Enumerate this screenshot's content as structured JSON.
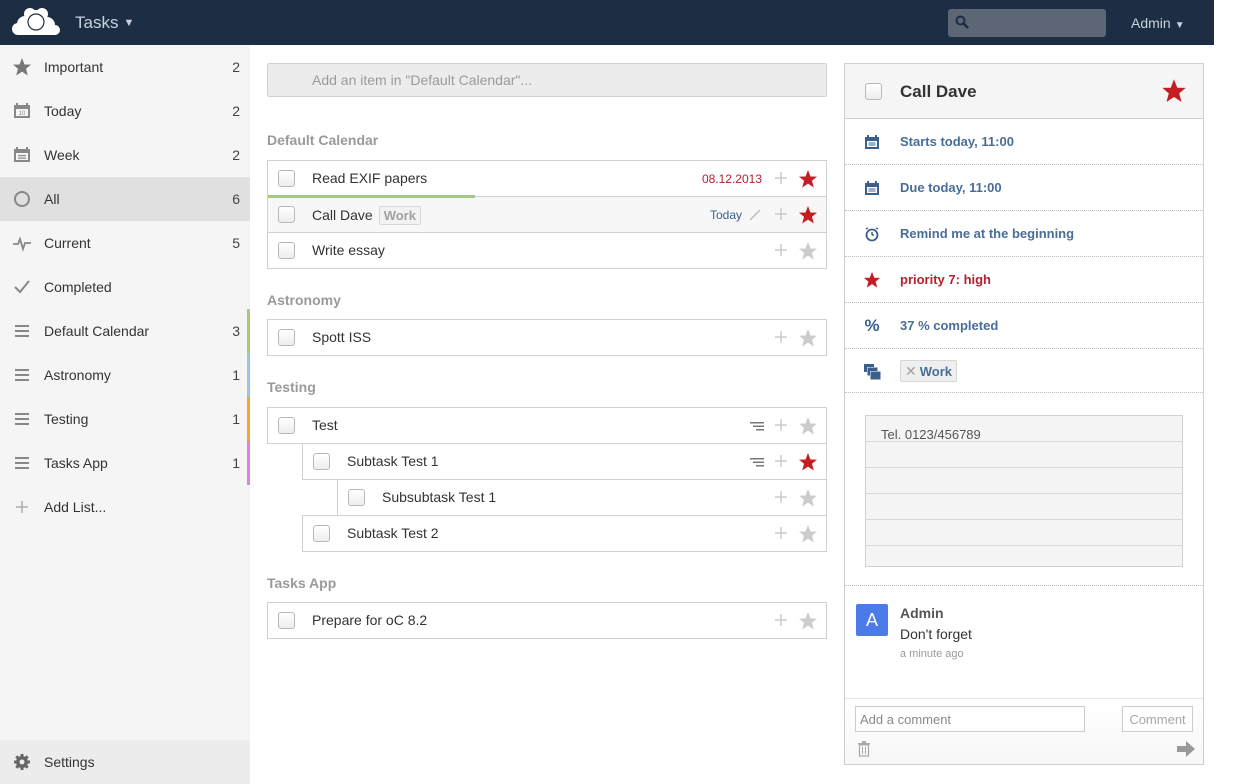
{
  "header": {
    "app_title": "Tasks",
    "search_placeholder": "",
    "user": "Admin"
  },
  "sidebar": {
    "items": [
      {
        "label": "Important",
        "count": "2",
        "icon": "star-icon"
      },
      {
        "label": "Today",
        "count": "2",
        "icon": "calendar-today-icon"
      },
      {
        "label": "Week",
        "count": "2",
        "icon": "calendar-week-icon"
      },
      {
        "label": "All",
        "count": "6",
        "icon": "circle-icon",
        "active": true
      },
      {
        "label": "Current",
        "count": "5",
        "icon": "pulse-icon"
      },
      {
        "label": "Completed",
        "count": "",
        "icon": "check-icon"
      }
    ],
    "lists": [
      {
        "label": "Default Calendar",
        "count": "3",
        "color": "#a5cf6f"
      },
      {
        "label": "Astronomy",
        "count": "1",
        "color": "#9dc3e6"
      },
      {
        "label": "Testing",
        "count": "1",
        "color": "#f5a623"
      },
      {
        "label": "Tasks App",
        "count": "1",
        "color": "#e27ee6"
      }
    ],
    "add_list": "Add List...",
    "settings": "Settings"
  },
  "main": {
    "add_placeholder": "Add an item in \"Default Calendar\"...",
    "groups": [
      {
        "title": "Default Calendar",
        "tasks": [
          {
            "title": "Read EXIF papers",
            "date": "08.12.2013",
            "starred": true
          },
          {
            "title": "Call Dave",
            "tag": "Work",
            "date": "Today",
            "starred": true,
            "selected": true,
            "progress_percent": 37
          },
          {
            "title": "Write essay",
            "starred": false
          }
        ]
      },
      {
        "title": "Astronomy",
        "tasks": [
          {
            "title": "Spott ISS",
            "starred": false
          }
        ]
      },
      {
        "title": "Testing",
        "tasks": [
          {
            "title": "Test",
            "starred": false,
            "has_subtasks": true
          },
          {
            "title": "Subtask Test 1",
            "starred": true,
            "has_subtasks": true,
            "level": 1
          },
          {
            "title": "Subsubtask Test 1",
            "starred": false,
            "level": 2
          },
          {
            "title": "Subtask Test 2",
            "starred": false,
            "level": 1
          }
        ]
      },
      {
        "title": "Tasks App",
        "tasks": [
          {
            "title": "Prepare for oC 8.2",
            "starred": false
          }
        ]
      }
    ]
  },
  "details": {
    "title": "Call Dave",
    "starred": true,
    "start": "Starts today, 11:00",
    "due": "Due today, 11:00",
    "reminder": "Remind me at the beginning",
    "priority": "priority 7: high",
    "completed": "37 % completed",
    "category": "Work",
    "note": "Tel. 0123/456789",
    "comment": {
      "avatar_letter": "A",
      "author": "Admin",
      "text": "Don't forget",
      "time": "a minute ago"
    },
    "comment_placeholder": "Add a comment",
    "comment_button": "Comment"
  },
  "colors": {
    "header_bg": "#1d2d44",
    "star_active": "#c41e24",
    "link_blue": "#4a6d97",
    "progress": "#a5cf6f"
  }
}
